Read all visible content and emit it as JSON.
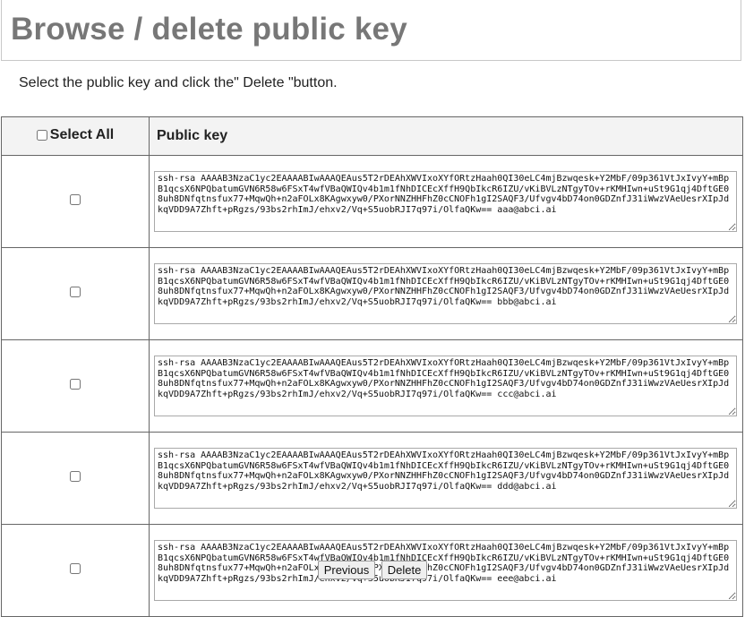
{
  "page": {
    "title": "Browse / delete public key",
    "instructions": "Select the public key and click the\" Delete \"button."
  },
  "table": {
    "select_all_label": "Select All",
    "public_key_header": "Public key",
    "rows": [
      {
        "checked": false,
        "key": "ssh-rsa AAAAB3NzaC1yc2EAAAABIwAAAQEAus5T2rDEAhXWVIxoXYfORtzHaah0QI30eLC4mjBzwqesk+Y2MbF/09p361VtJxIvyY+mBpB1qcsX6NPQbatumGVN6R58w6FSxT4wfVBaQWIQv4b1m1fNhDICEcXffH9QbIkcR6IZU/vKiBVLzNTgyTOv+rKMHIwn+uSt9G1qj4DftGE08uh8DNfqtnsfux77+MqwQh+n2aFOLx8KAgwxyw0/PXorNNZHHFhZ0cCNOFh1gI2SAQF3/Ufvgv4bD74on0GDZnfJ31iWwzVAeUesrXIpJdkqVDD9A7Zhft+pRgzs/93bs2rhImJ/ehxv2/Vq+S5uobRJI7q97i/OlfaQKw== aaa@abci.ai"
      },
      {
        "checked": false,
        "key": "ssh-rsa AAAAB3NzaC1yc2EAAAABIwAAAQEAus5T2rDEAhXWVIxoXYfORtzHaah0QI30eLC4mjBzwqesk+Y2MbF/09p361VtJxIvyY+mBpB1qcsX6NPQbatumGVN6R58w6FSxT4wfVBaQWIQv4b1m1fNhDICEcXffH9QbIkcR6IZU/vKiBVLzNTgyTOv+rKMHIwn+uSt9G1qj4DftGE08uh8DNfqtnsfux77+MqwQh+n2aFOLx8KAgwxyw0/PXorNNZHHFhZ0cCNOFh1gI2SAQF3/Ufvgv4bD74on0GDZnfJ31iWwzVAeUesrXIpJdkqVDD9A7Zhft+pRgzs/93bs2rhImJ/ehxv2/Vq+S5uobRJI7q97i/OlfaQKw== bbb@abci.ai"
      },
      {
        "checked": false,
        "key": "ssh-rsa AAAAB3NzaC1yc2EAAAABIwAAAQEAus5T2rDEAhXWVIxoXYfORtzHaah0QI30eLC4mjBzwqesk+Y2MbF/09p361VtJxIvyY+mBpB1qcsX6NPQbatumGVN6R58w6FSxT4wfVBaQWIQv4b1m1fNhDICEcXffH9QbIkcR6IZU/vKiBVLzNTgyTOv+rKMHIwn+uSt9G1qj4DftGE08uh8DNfqtnsfux77+MqwQh+n2aFOLx8KAgwxyw0/PXorNNZHHFhZ0cCNOFh1gI2SAQF3/Ufvgv4bD74on0GDZnfJ31iWwzVAeUesrXIpJdkqVDD9A7Zhft+pRgzs/93bs2rhImJ/ehxv2/Vq+S5uobRJI7q97i/OlfaQKw== ccc@abci.ai"
      },
      {
        "checked": false,
        "key": "ssh-rsa AAAAB3NzaC1yc2EAAAABIwAAAQEAus5T2rDEAhXWVIxoXYfORtzHaah0QI30eLC4mjBzwqesk+Y2MbF/09p361VtJxIvyY+mBpB1qcsX6NPQbatumGVN6R58w6FSxT4wfVBaQWIQv4b1m1fNhDICEcXffH9QbIkcR6IZU/vKiBVLzNTgyTOv+rKMHIwn+uSt9G1qj4DftGE08uh8DNfqtnsfux77+MqwQh+n2aFOLx8KAgwxyw0/PXorNNZHHFhZ0cCNOFh1gI2SAQF3/Ufvgv4bD74on0GDZnfJ31iWwzVAeUesrXIpJdkqVDD9A7Zhft+pRgzs/93bs2rhImJ/ehxv2/Vq+S5uobRJI7q97i/OlfaQKw== ddd@abci.ai"
      },
      {
        "checked": false,
        "key": "ssh-rsa AAAAB3NzaC1yc2EAAAABIwAAAQEAus5T2rDEAhXWVIxoXYfORtzHaah0QI30eLC4mjBzwqesk+Y2MbF/09p361VtJxIvyY+mBpB1qcsX6NPQbatumGVN6R58w6FSxT4wfVBaQWIQv4b1m1fNhDICEcXffH9QbIkcR6IZU/vKiBVLzNTgyTOv+rKMHIwn+uSt9G1qj4DftGE08uh8DNfqtnsfux77+MqwQh+n2aFOLx8KAgwxyw0/PXorNNZHHFhZ0cCNOFh1gI2SAQF3/Ufvgv4bD74on0GDZnfJ31iWwzVAeUesrXIpJdkqVDD9A7Zhft+pRgzs/93bs2rhImJ/ehxv2/Vq+S5uobRJI7q97i/OlfaQKw== eee@abci.ai"
      }
    ]
  },
  "pager": {
    "previous_label": "Previous",
    "delete_label": "Delete"
  }
}
